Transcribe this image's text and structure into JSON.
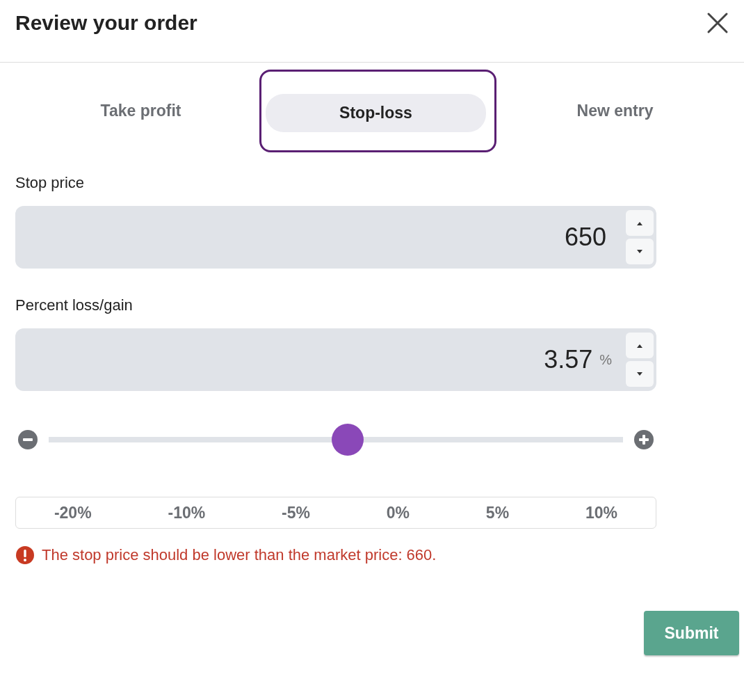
{
  "dialog": {
    "title": "Review your order"
  },
  "tabs": [
    {
      "label": "Take profit",
      "selected": false
    },
    {
      "label": "Stop-loss",
      "selected": true
    },
    {
      "label": "New entry",
      "selected": false
    }
  ],
  "stop_price": {
    "label": "Stop price",
    "value": "650"
  },
  "percent": {
    "label": "Percent loss/gain",
    "value": "3.57",
    "unit": "%"
  },
  "slider": {
    "level": 0.52
  },
  "presets": [
    {
      "label": "-20%"
    },
    {
      "label": "-10%"
    },
    {
      "label": "-5%"
    },
    {
      "label": "0%"
    },
    {
      "label": "5%"
    },
    {
      "label": "10%"
    }
  ],
  "error": {
    "message": "The stop price should be lower than the market price: 660."
  },
  "submit": {
    "label": "Submit"
  }
}
